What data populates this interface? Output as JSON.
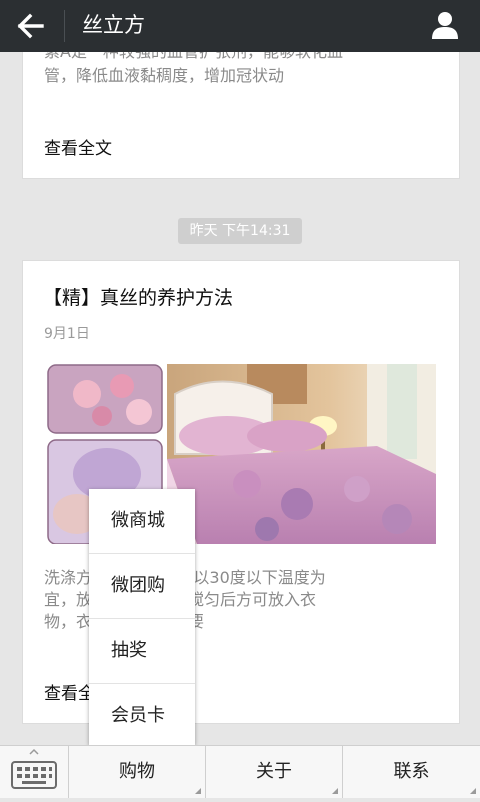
{
  "header": {
    "title": "丝立方",
    "back_icon": "arrow-left-icon",
    "profile_icon": "person-icon"
  },
  "cards": [
    {
      "excerpt_lines": [
        "素A是一种较强的血管扩张剂，能够软化血",
        "管，降低血液黏稠度，增加冠状动"
      ],
      "readmore": "查看全文"
    },
    {
      "title": "【精】真丝的养护方法",
      "date": "9月1日",
      "excerpt_lines": [
        "洗涤方式以手洗最佳:以30度以下温度为",
        "宜，放入适量洗涤剂搅匀后方可放入衣",
        "物，衣物浸泡时间不要"
      ],
      "readmore": "查看全文"
    }
  ],
  "timestamp": "昨天 下午14:31",
  "popup_menu": {
    "items": [
      "微商城",
      "微团购",
      "抽奖",
      "会员卡"
    ]
  },
  "bottom_bar": {
    "keyboard_icon": "keyboard-icon",
    "menus": [
      "购物",
      "关于",
      "联系"
    ]
  },
  "colors": {
    "header_bg": "#2b2f32",
    "page_bg": "#e6e6e6",
    "pill_bg": "#cfcfcf"
  }
}
